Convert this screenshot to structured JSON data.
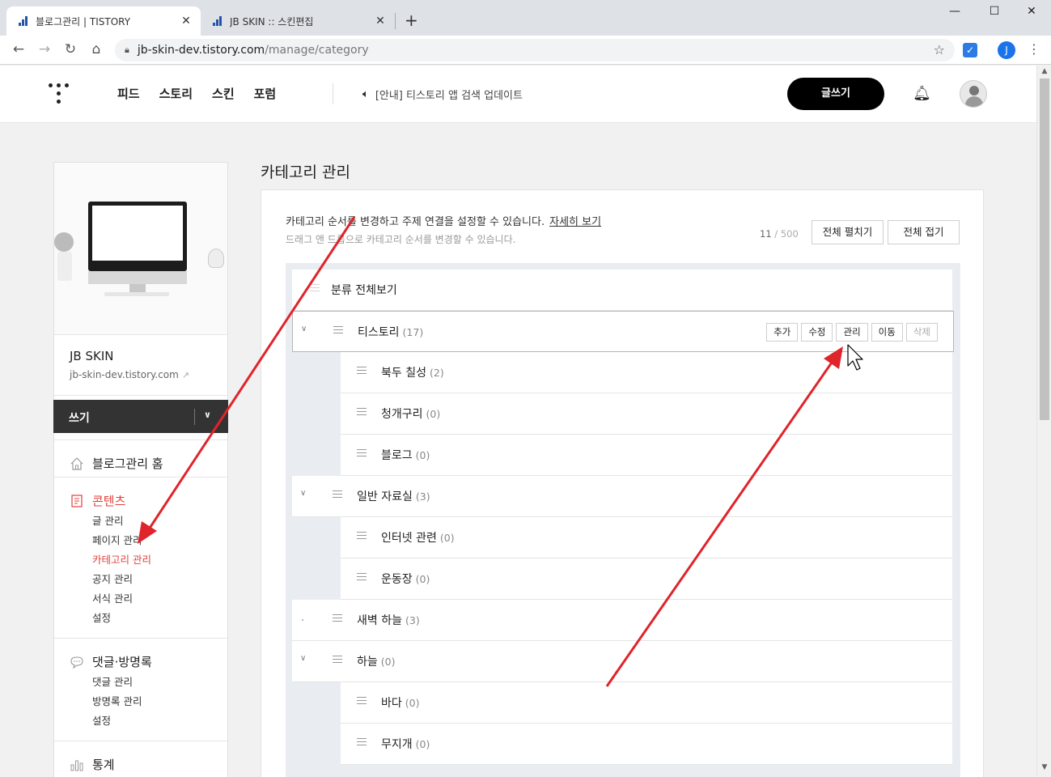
{
  "browser": {
    "tabs": [
      {
        "title": "블로그관리 | TISTORY",
        "active": true
      },
      {
        "title": "JB SKIN :: 스킨편집",
        "active": false
      }
    ],
    "url_host": "jb-skin-dev.tistory.com",
    "url_path": "/manage/category",
    "profile_letter": "J"
  },
  "header": {
    "menu": [
      "피드",
      "스토리",
      "스킨",
      "포럼"
    ],
    "notice": "[안내] 티스토리 앱 검색 업데이트",
    "write_label": "글쓰기"
  },
  "sidebar": {
    "blog_name": "JB SKIN",
    "blog_url": "jb-skin-dev.tistory.com",
    "write_label": "쓰기",
    "home_label": "블로그관리 홈",
    "contents": {
      "label": "콘텐츠",
      "items": [
        "글 관리",
        "페이지 관리",
        "카테고리 관리",
        "공지 관리",
        "서식 관리",
        "설정"
      ]
    },
    "comments": {
      "label": "댓글·방명록",
      "items": [
        "댓글 관리",
        "방명록 관리",
        "설정"
      ]
    },
    "stats_label": "통계"
  },
  "main": {
    "title": "카테고리 관리",
    "desc1": "카테고리 순서를 변경하고 주제 연결을 설정할 수 있습니다.",
    "detail_link": "자세히 보기",
    "desc2": "드래그 앤 드롭으로 카테고리 순서를 변경할 수 있습니다.",
    "count": "11",
    "count_total": "/ 500",
    "expand_all": "전체 펼치기",
    "collapse_all": "전체 접기",
    "root_label": "분류 전체보기",
    "actions": [
      "추가",
      "수정",
      "관리",
      "이동",
      "삭제"
    ],
    "categories": [
      {
        "name": "티스토리",
        "count": "(17)"
      },
      {
        "name": "북두 칠성",
        "count": "(2)"
      },
      {
        "name": "청개구리",
        "count": "(0)"
      },
      {
        "name": "블로그",
        "count": "(0)"
      },
      {
        "name": "일반 자료실",
        "count": "(3)"
      },
      {
        "name": "인터넷 관련",
        "count": "(0)"
      },
      {
        "name": "운동장",
        "count": "(0)"
      },
      {
        "name": "새벽 하늘",
        "count": "(3)"
      },
      {
        "name": "하늘",
        "count": "(0)"
      },
      {
        "name": "바다",
        "count": "(0)"
      },
      {
        "name": "무지개",
        "count": "(0)"
      }
    ]
  },
  "colors": {
    "accent_red": "#e1413c",
    "annotation_arrow": "#e0242b"
  }
}
